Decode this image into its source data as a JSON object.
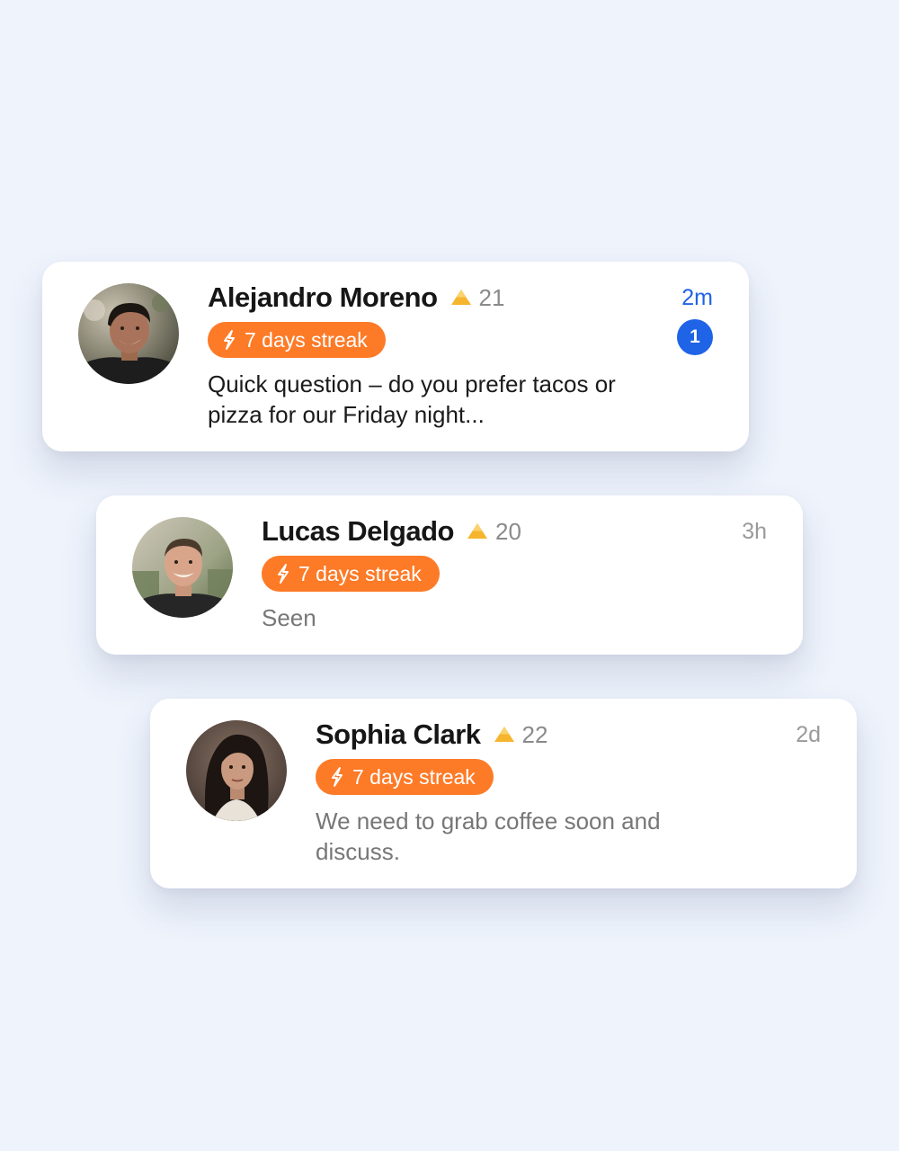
{
  "conversations": [
    {
      "name": "Alejandro Moreno",
      "level_icon": "triangle-rank-icon",
      "level": "21",
      "streak": "7 days streak",
      "streak_icon": "bolt-icon",
      "message": "Quick question – do you prefer tacos or pizza for our Friday night...",
      "time": "2m",
      "unread": "1",
      "avatar": "avatar-alejandro"
    },
    {
      "name": "Lucas Delgado",
      "level_icon": "triangle-rank-icon",
      "level": "20",
      "streak": "7 days streak",
      "streak_icon": "bolt-icon",
      "message": "Seen",
      "time": "3h",
      "avatar": "avatar-lucas"
    },
    {
      "name": "Sophia Clark",
      "level_icon": "triangle-rank-icon",
      "level": "22",
      "streak": "7 days streak",
      "streak_icon": "bolt-icon",
      "message": "We need to grab coffee soon and discuss.",
      "time": "2d",
      "avatar": "avatar-sophia"
    }
  ],
  "colors": {
    "background": "#eef3fc",
    "card": "#ffffff",
    "streak_badge": "#fd7a27",
    "accent_blue": "#1f63e6",
    "rank_icon": "#f6b52e",
    "muted_text": "#8a8a8a"
  }
}
